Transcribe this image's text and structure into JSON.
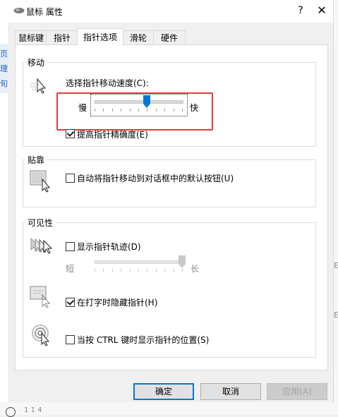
{
  "dialog": {
    "title": "鼠标 属性",
    "help_glyph": "?",
    "close_glyph": "✕"
  },
  "tabs": [
    {
      "label": "鼠标键",
      "active": false
    },
    {
      "label": "指针",
      "active": false
    },
    {
      "label": "指针选项",
      "active": true
    },
    {
      "label": "滑轮",
      "active": false
    },
    {
      "label": "硬件",
      "active": false
    }
  ],
  "motion": {
    "group_title": "移动",
    "speed_label": "选择指针移动速度(C):",
    "slow_label": "慢",
    "fast_label": "快",
    "speed_level": 0.6,
    "precision_label": "提高指针精确度(E)",
    "precision_checked": true
  },
  "snap": {
    "group_title": "贴靠",
    "snap_label": "自动将指针移动到对话框中的默认按钮(U)",
    "snap_checked": false
  },
  "visibility": {
    "group_title": "可见性",
    "trails_label": "显示指针轨迹(D)",
    "trails_checked": false,
    "short_label": "短",
    "long_label": "长",
    "trail_level": 1.0,
    "hide_label": "在打字时隐藏指针(H)",
    "hide_checked": true,
    "ctrl_label": "当按 CTRL 键时显示指针的位置(S)",
    "ctrl_checked": false
  },
  "buttons": {
    "ok": "确定",
    "cancel": "取消",
    "apply": "应用(A)"
  },
  "background": {
    "left_fragments": [
      "页",
      "理",
      "旬"
    ],
    "right_fragments": [
      "E",
      "E"
    ],
    "bottom_fragment": "1 1 4"
  },
  "colors": {
    "accent": "#0078d7",
    "highlight_box": "#e23b3b"
  }
}
